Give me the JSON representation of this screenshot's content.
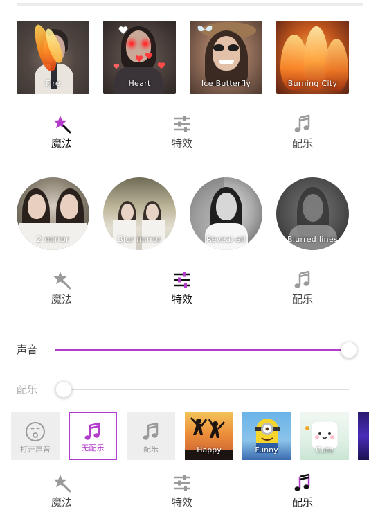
{
  "colors": {
    "accent": "#b43ccd",
    "inactive_icon": "#9a9a9a",
    "active_icon": "#111111"
  },
  "effects_row": [
    {
      "label": "Fire"
    },
    {
      "label": "Heart"
    },
    {
      "label": "Ice Butterfly"
    },
    {
      "label": "Burning City"
    }
  ],
  "tabbar_1": [
    {
      "label": "魔法",
      "icon": "magic-wand-icon",
      "active": true
    },
    {
      "label": "特效",
      "icon": "sliders-icon",
      "active": false
    },
    {
      "label": "配乐",
      "icon": "music-note-icon",
      "active": false
    }
  ],
  "filters_row": [
    {
      "label": "2 mirror"
    },
    {
      "label": "Blur mirror"
    },
    {
      "label": "Reveal-all"
    },
    {
      "label": "Blurred lines"
    }
  ],
  "tabbar_2": [
    {
      "label": "魔法",
      "icon": "magic-wand-icon",
      "active": false
    },
    {
      "label": "特效",
      "icon": "sliders-icon",
      "active": true
    },
    {
      "label": "配乐",
      "icon": "music-note-icon",
      "active": false
    }
  ],
  "sliders": {
    "sound": {
      "label": "声音",
      "value": 1.0
    },
    "music": {
      "label": "配乐",
      "value": 0.0
    }
  },
  "music_row": [
    {
      "label": "打开声音",
      "icon": "mute-face-icon"
    },
    {
      "label": "无配乐",
      "icon": "music-note-icon",
      "selected": true
    },
    {
      "label": "配乐",
      "icon": "music-note-icon"
    },
    {
      "label": "Happy"
    },
    {
      "label": "Funny"
    },
    {
      "label": "Cute"
    }
  ],
  "tabbar_3": [
    {
      "label": "魔法",
      "icon": "magic-wand-icon",
      "active": false
    },
    {
      "label": "特效",
      "icon": "sliders-icon",
      "active": false
    },
    {
      "label": "配乐",
      "icon": "music-note-icon",
      "active": true
    }
  ]
}
